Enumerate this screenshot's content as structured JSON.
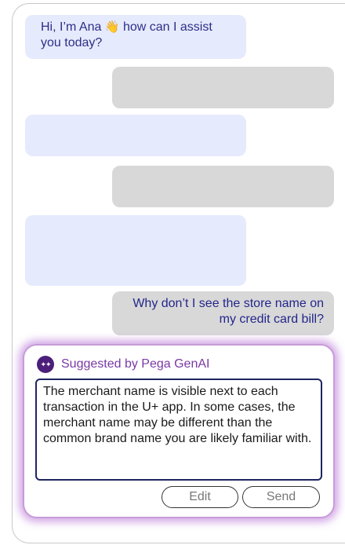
{
  "chat": {
    "greeting_text": "Hi, I’m Ana",
    "greeting_emoji": "👋",
    "greeting_rest": " how can I assist you today?",
    "user_question": "Why don’t I see the store name on my credit card bill?"
  },
  "suggestion": {
    "title": "Suggested by Pega GenAI",
    "icon": "sparkle-icon",
    "text": "The merchant name is visible next to each transaction in the U+ app. In some cases, the merchant name may be different than the common brand name you are likely familiar with.",
    "edit_label": "Edit",
    "send_label": "Send"
  },
  "colors": {
    "bot_bubble": "#e6eafd",
    "user_bubble": "#d8d8d8",
    "accent": "#7a3aa6"
  }
}
